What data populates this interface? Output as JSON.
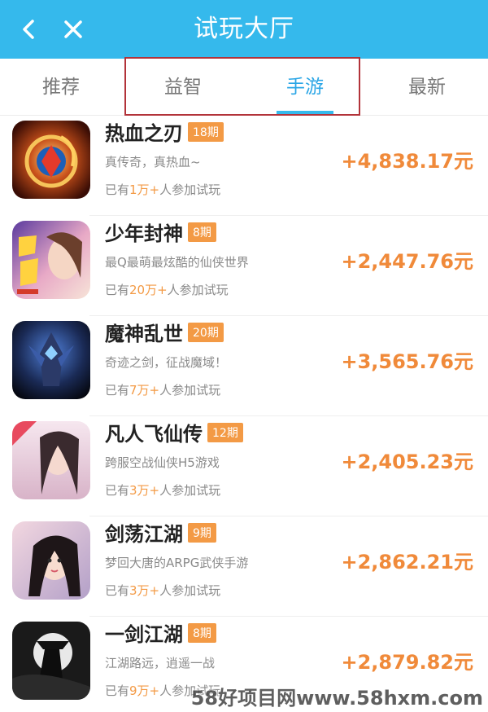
{
  "header": {
    "title": "试玩大厅",
    "back_icon": "chevron-left-icon",
    "close_icon": "close-icon",
    "background": "#35b9ec"
  },
  "tabs": [
    {
      "label": "推荐",
      "active": false
    },
    {
      "label": "益智",
      "active": false
    },
    {
      "label": "手游",
      "active": true
    },
    {
      "label": "最新",
      "active": false
    }
  ],
  "colors": {
    "accent": "#35b9ec",
    "reward": "#f08a3a",
    "badge": "#f39a45",
    "highlight_box": "#b2333a"
  },
  "games": [
    {
      "name": "热血之刃",
      "period": "18期",
      "desc": "真传奇，真热血~",
      "players_prefix": "已有",
      "players_num": "1万+",
      "players_suffix": "人参加试玩",
      "reward": "+4,838.17元",
      "icon": "game-icon-rexuezhiren"
    },
    {
      "name": "少年封神",
      "period": "8期",
      "desc": "最Q最萌最炫酷的仙侠世界",
      "players_prefix": "已有",
      "players_num": "20万+",
      "players_suffix": "人参加试玩",
      "reward": "+2,447.76元",
      "icon": "game-icon-shaonianfengshen"
    },
    {
      "name": "魔神乱世",
      "period": "20期",
      "desc": "奇迹之剑，征战魔域！",
      "players_prefix": "已有",
      "players_num": "7万+",
      "players_suffix": "人参加试玩",
      "reward": "+3,565.76元",
      "icon": "game-icon-moshenluanshi"
    },
    {
      "name": "凡人飞仙传",
      "period": "12期",
      "desc": "跨服空战仙侠H5游戏",
      "players_prefix": "已有",
      "players_num": "3万+",
      "players_suffix": "人参加试玩",
      "reward": "+2,405.23元",
      "icon": "game-icon-fanrenfeixianzhuan"
    },
    {
      "name": "剑荡江湖",
      "period": "9期",
      "desc": "梦回大唐的ARPG武侠手游",
      "players_prefix": "已有",
      "players_num": "3万+",
      "players_suffix": "人参加试玩",
      "reward": "+2,862.21元",
      "icon": "game-icon-jiandangjianghu"
    },
    {
      "name": "一剑江湖",
      "period": "8期",
      "desc": "江湖路远，逍遥一战",
      "players_prefix": "已有",
      "players_num": "9万+",
      "players_suffix": "人参加试玩",
      "reward": "+2,879.82元",
      "icon": "game-icon-yijianjianghu"
    }
  ],
  "watermark": "58好项目网www.58hxm.com"
}
